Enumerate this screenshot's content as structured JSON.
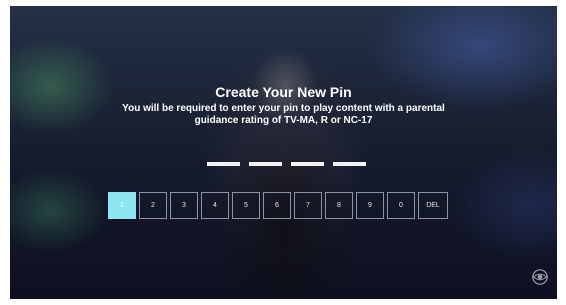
{
  "dialog": {
    "title": "Create Your New Pin",
    "subtitle": "You will be required to enter your pin to play content with a parental guidance rating of TV-MA, R or NC-17"
  },
  "pin": {
    "length": 4
  },
  "keypad": {
    "keys": [
      "1",
      "2",
      "3",
      "4",
      "5",
      "6",
      "7",
      "8",
      "9",
      "0",
      "DEL"
    ],
    "selected": "1"
  },
  "colors": {
    "selected_key": "#8fe6f2",
    "text": "#ffffff"
  },
  "watermark": {
    "icon": "cbs-eye-logo-icon"
  }
}
